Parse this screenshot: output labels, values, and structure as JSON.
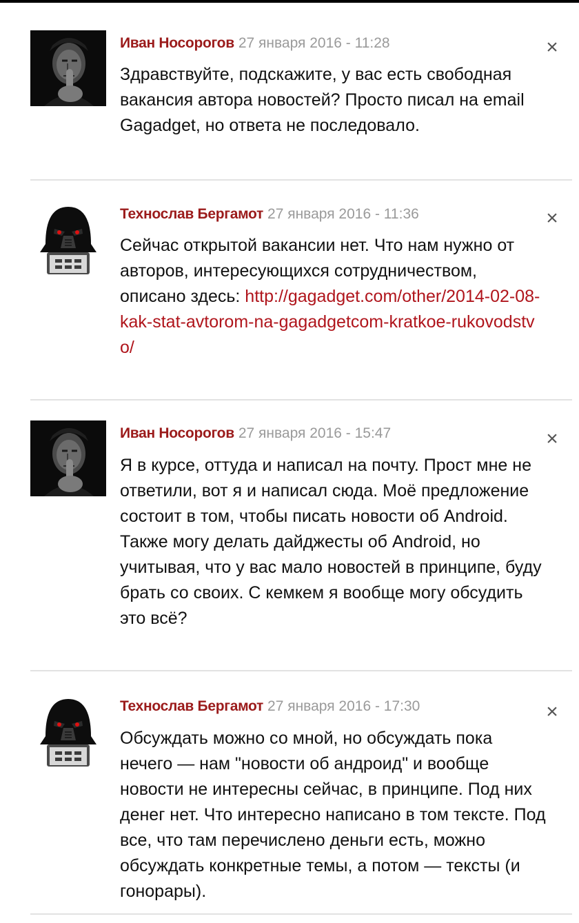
{
  "comments": [
    {
      "author": "Иван Носорогов",
      "date": "27 января 2016 - 11:28",
      "avatar": "man-portrait",
      "text": "Здравствуйте, подскажите, у вас есть свободная вакансия автора новостей? Просто писал на email Gagadget, но ответа не последовало.",
      "close_label": "×"
    },
    {
      "author": "Технослав Бергамот",
      "date": "27 января 2016 - 11:36",
      "avatar": "darth-vader-figure",
      "text": "Сейчас открытой вакансии нет. Что нам нужно от авторов, интересующихся сотрудничеством, описано здесь: ",
      "link": "http://gagadget.com/other/2014-02-08-kak-stat-avtorom-na-gagadgetcom-kratkoe-rukovodstvo/",
      "close_label": "×"
    },
    {
      "author": "Иван Носорогов",
      "date": "27 января 2016 - 15:47",
      "avatar": "man-portrait",
      "text": "Я в курсе, оттуда и написал на почту. Прост мне не ответили, вот я и написал сюда. Моё предложение состоит в том, чтобы писать новости об Android. Также могу делать дайджесты об Android, но учитывая, что у вас мало новостей в принципе, буду брать со своих. С кемкем я вообще могу обсудить это всё?",
      "close_label": "×"
    },
    {
      "author": "Технослав Бергамот",
      "date": "27 января 2016 - 17:30",
      "avatar": "darth-vader-figure",
      "text": "Обсуждать можно со мной, но обсуждать пока нечего — нам \"новости об андроид\" и вообще новости не интересны сейчас, в принципе. Под них денег нет. Что интересно написано в том тексте. Под все, что там перечислено деньги есть, можно обсуждать конкретные темы, а потом — тексты (и гонорары).",
      "close_label": "×"
    }
  ],
  "colors": {
    "author": "#9b1b1b",
    "link": "#b0151c",
    "date": "#9a9a9a",
    "divider": "#e2e2e2"
  }
}
